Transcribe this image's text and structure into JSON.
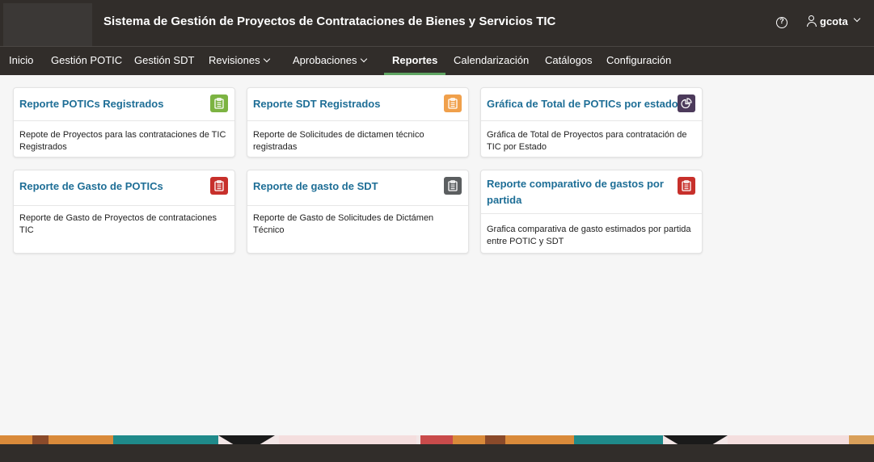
{
  "header": {
    "title": "Sistema de Gestión de Proyectos de Contrataciones de Bienes y Servicios TIC",
    "user": "gcota"
  },
  "nav": {
    "items": [
      "Inicio",
      "Gestión POTIC",
      "Gestión SDT",
      "Revisiones",
      "Aprobaciones",
      "Reportes",
      "Calendarización",
      "Catálogos",
      "Configuración"
    ],
    "active": "Reportes"
  },
  "cards": [
    {
      "title": "Reporte POTICs Registrados",
      "desc": "Repote de Proyectos para las contrataciones de TIC Registrados",
      "icon": "clipboard-icon",
      "color": "#7cb342"
    },
    {
      "title": "Reporte SDT Registrados",
      "desc": "Reporte de Solicitudes de dictamen técnico registradas",
      "icon": "clipboard-icon",
      "color": "#f0a04b"
    },
    {
      "title": "Gráfica de Total de POTICs por estado",
      "desc": "Gráfica de Total de Proyectos para contratación de TIC por Estado",
      "icon": "pie-chart-icon",
      "color": "#4c3a5b"
    },
    {
      "title": "Reporte de Gasto de POTICs",
      "desc": "Reporte de Gasto de Proyectos de contrataciones TIC",
      "icon": "clipboard-icon",
      "color": "#c7302b"
    },
    {
      "title": "Reporte de gasto de SDT",
      "desc": "Reporte de Gasto de Solicitudes de Dictámen Técnico",
      "icon": "clipboard-icon",
      "color": "#5b5e60"
    },
    {
      "title": "Reporte comparativo de gastos por partida",
      "desc": "Grafica comparativa de gasto estimados por partida entre POTIC y SDT",
      "icon": "clipboard-icon",
      "color": "#c7302b"
    }
  ]
}
